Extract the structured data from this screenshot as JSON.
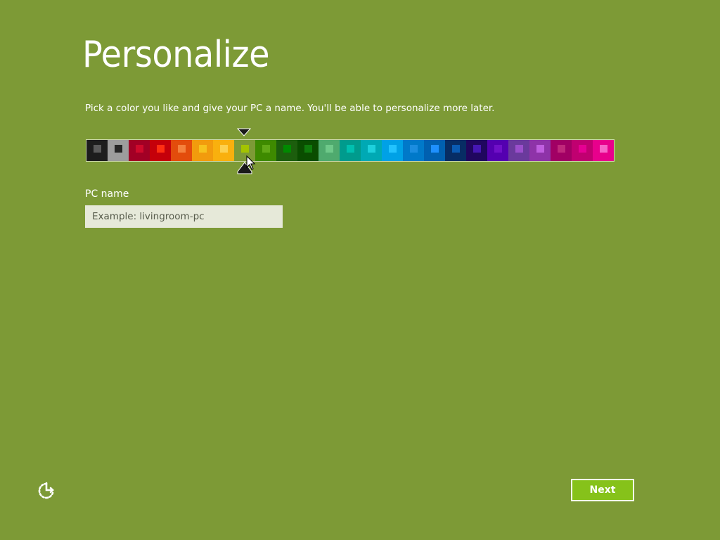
{
  "theme": {
    "background": "#7d9a36",
    "input_background": "#e6e9d9",
    "next_button_background": "#86c21a"
  },
  "header": {
    "title": "Personalize"
  },
  "instructions": "Pick a color you like and give your PC a name. You'll be able to personalize more later.",
  "color_picker": {
    "selected_index": 7,
    "swatches": [
      {
        "color": "#1d1d1d",
        "accent": "#5a5a5a"
      },
      {
        "color": "#9d9d9d",
        "accent": "#262626"
      },
      {
        "color": "#a20025",
        "accent": "#cf0a2c"
      },
      {
        "color": "#c5000a",
        "accent": "#ff2e12"
      },
      {
        "color": "#e34c0c",
        "accent": "#f5813d"
      },
      {
        "color": "#f29b0d",
        "accent": "#f7c21d"
      },
      {
        "color": "#f9b00e",
        "accent": "#fdd14f"
      },
      {
        "color": "#7d9a36",
        "accent": "#a4c400"
      },
      {
        "color": "#3e8a00",
        "accent": "#60a917"
      },
      {
        "color": "#1c5e0d",
        "accent": "#008a00"
      },
      {
        "color": "#0a4d00",
        "accent": "#0f7b0c"
      },
      {
        "color": "#4faa6e",
        "accent": "#6fc98a"
      },
      {
        "color": "#009b8d",
        "accent": "#00c0b0"
      },
      {
        "color": "#00a9b4",
        "accent": "#1ed1dd"
      },
      {
        "color": "#00a1e6",
        "accent": "#22c3ff"
      },
      {
        "color": "#0079c9",
        "accent": "#1b8de0"
      },
      {
        "color": "#0060b0",
        "accent": "#1e90ff"
      },
      {
        "color": "#072d64",
        "accent": "#0a5bb3"
      },
      {
        "color": "#20075e",
        "accent": "#4617b4"
      },
      {
        "color": "#5400b0",
        "accent": "#7010c8"
      },
      {
        "color": "#6a3a9c",
        "accent": "#9b4fcc"
      },
      {
        "color": "#8e33a8",
        "accent": "#c05fe0"
      },
      {
        "color": "#a10064",
        "accent": "#c0287a"
      },
      {
        "color": "#c00070",
        "accent": "#e60093"
      },
      {
        "color": "#e8008c",
        "accent": "#f765c8"
      }
    ]
  },
  "pc_name": {
    "label": "PC name",
    "placeholder": "Example: livingroom-pc",
    "value": ""
  },
  "footer": {
    "accessibility_icon": "ease-of-access-icon",
    "next_label": "Next"
  }
}
